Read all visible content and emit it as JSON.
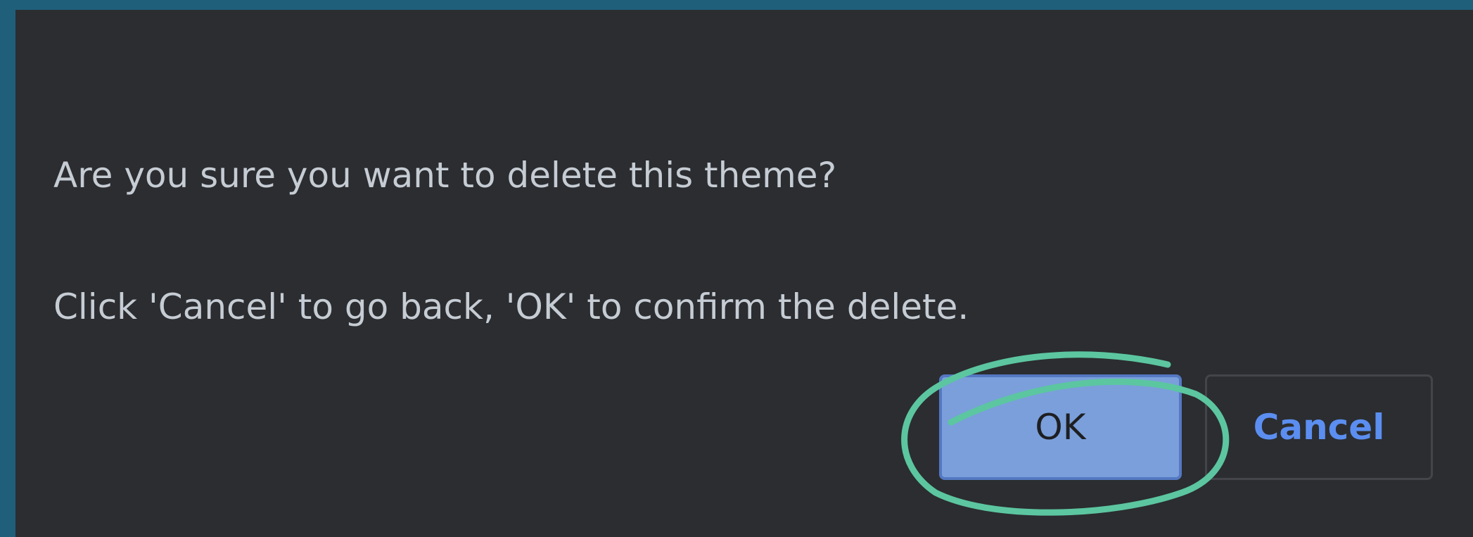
{
  "dialog": {
    "message_line_1": "Are you sure you want to delete this theme?",
    "message_line_2": "Click 'Cancel' to go back, 'OK' to confirm the delete.",
    "ok_label": "OK",
    "cancel_label": "Cancel"
  },
  "colors": {
    "window_border": "#1f5f7a",
    "dialog_background": "#2b2d30",
    "message_text": "#c6ccd4",
    "ok_background": "#7a9fdb",
    "cancel_text": "#5b8ef0",
    "highlight_annotation": "#5cc6a0"
  }
}
